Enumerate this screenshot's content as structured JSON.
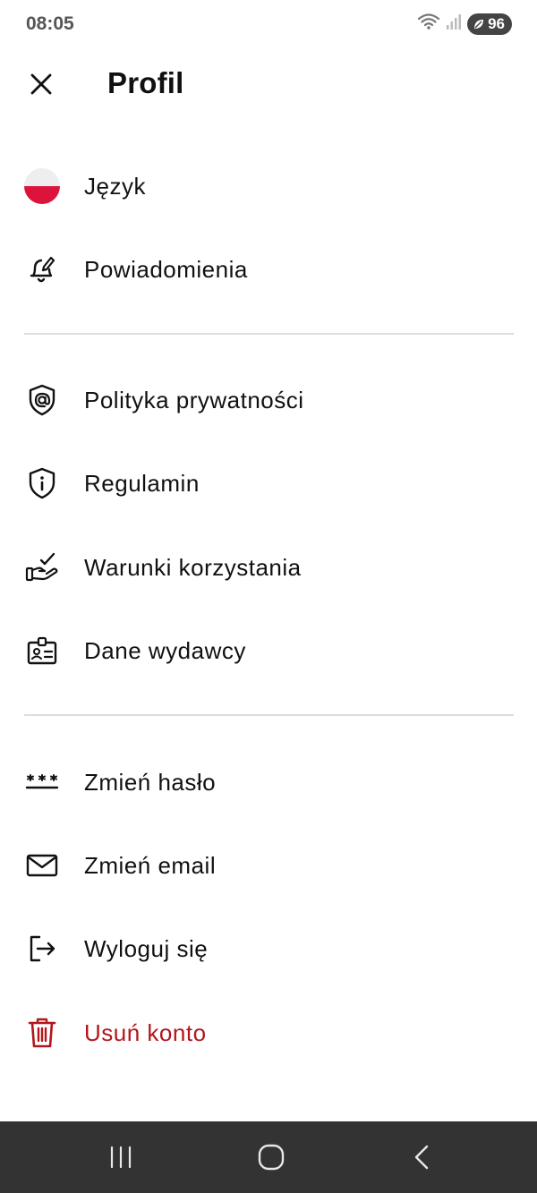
{
  "status_bar": {
    "time": "08:05",
    "battery_level": "96",
    "icons": [
      "wifi-icon",
      "signal-icon",
      "battery-icon"
    ]
  },
  "header": {
    "title": "Profil",
    "close_icon": "close-icon"
  },
  "menu": {
    "sections": [
      {
        "items": [
          {
            "label": "Język",
            "icon": "poland-flag-icon"
          },
          {
            "label": "Powiadomienia",
            "icon": "bell-edit-icon"
          }
        ]
      },
      {
        "items": [
          {
            "label": "Polityka prywatności",
            "icon": "shield-at-icon"
          },
          {
            "label": "Regulamin",
            "icon": "shield-info-icon"
          },
          {
            "label": "Warunki korzystania",
            "icon": "hand-check-icon"
          },
          {
            "label": "Dane wydawcy",
            "icon": "id-badge-icon"
          }
        ]
      },
      {
        "items": [
          {
            "label": "Zmień hasło",
            "icon": "password-icon"
          },
          {
            "label": "Zmień email",
            "icon": "envelope-icon"
          },
          {
            "label": "Wyloguj się",
            "icon": "logout-icon"
          },
          {
            "label": "Usuń konto",
            "icon": "trash-icon"
          }
        ]
      }
    ]
  },
  "colors": {
    "text": "#111111",
    "danger": "#b3161c",
    "divider": "#dddddd",
    "nav_bar": "#333333",
    "flag_red": "#dc143c"
  },
  "nav_bar": {
    "icons": [
      "recent-apps-icon",
      "home-icon",
      "back-icon"
    ]
  }
}
